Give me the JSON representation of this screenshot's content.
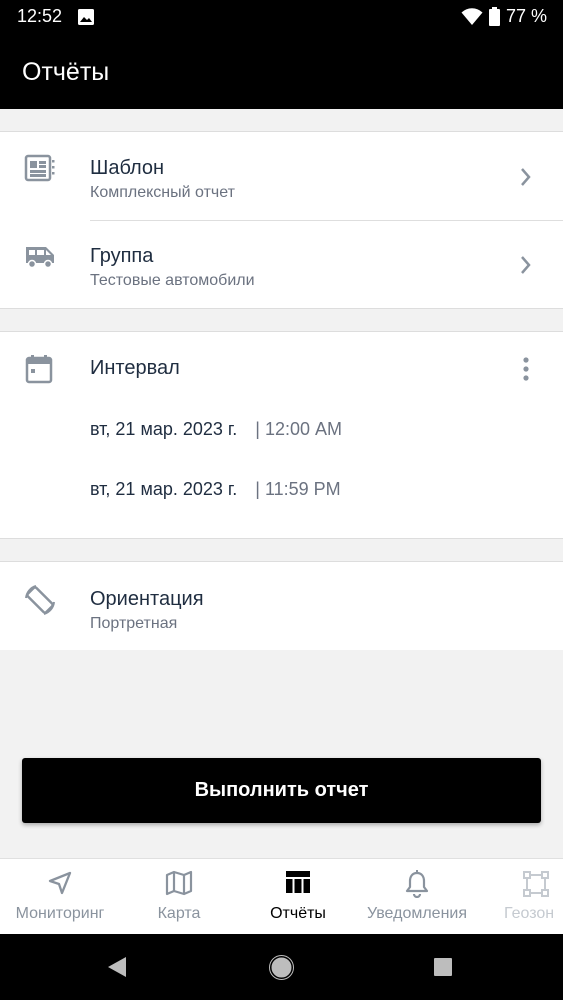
{
  "status_bar": {
    "time": "12:52",
    "battery": "77 %"
  },
  "appbar": {
    "title": "Отчёты"
  },
  "template_row": {
    "title": "Шаблон",
    "subtitle": "Комплексный отчет"
  },
  "group_row": {
    "title": "Группа",
    "subtitle": "Тестовые автомобили"
  },
  "interval": {
    "title": "Интервал",
    "from_date": "вт, 21 мар. 2023 г.",
    "from_time": "| 12:00 AM",
    "to_date": "вт, 21 мар. 2023 г.",
    "to_time": "| 11:59 PM"
  },
  "orientation": {
    "title": "Ориентация",
    "subtitle": "Портретная"
  },
  "run_button": {
    "label": "Выполнить отчет"
  },
  "bottom_nav": {
    "items": [
      {
        "label": "Мониторинг",
        "icon": "navigation-arrow-icon"
      },
      {
        "label": "Карта",
        "icon": "map-icon"
      },
      {
        "label": "Отчёты",
        "icon": "table-icon",
        "active": true
      },
      {
        "label": "Уведомления",
        "icon": "bell-icon"
      },
      {
        "label": "Геозон",
        "icon": "geofence-icon"
      }
    ]
  },
  "colors": {
    "primary": "#000000",
    "text": "#1f2d40",
    "secondary_text": "#6b7280",
    "icon": "#8a939e"
  }
}
